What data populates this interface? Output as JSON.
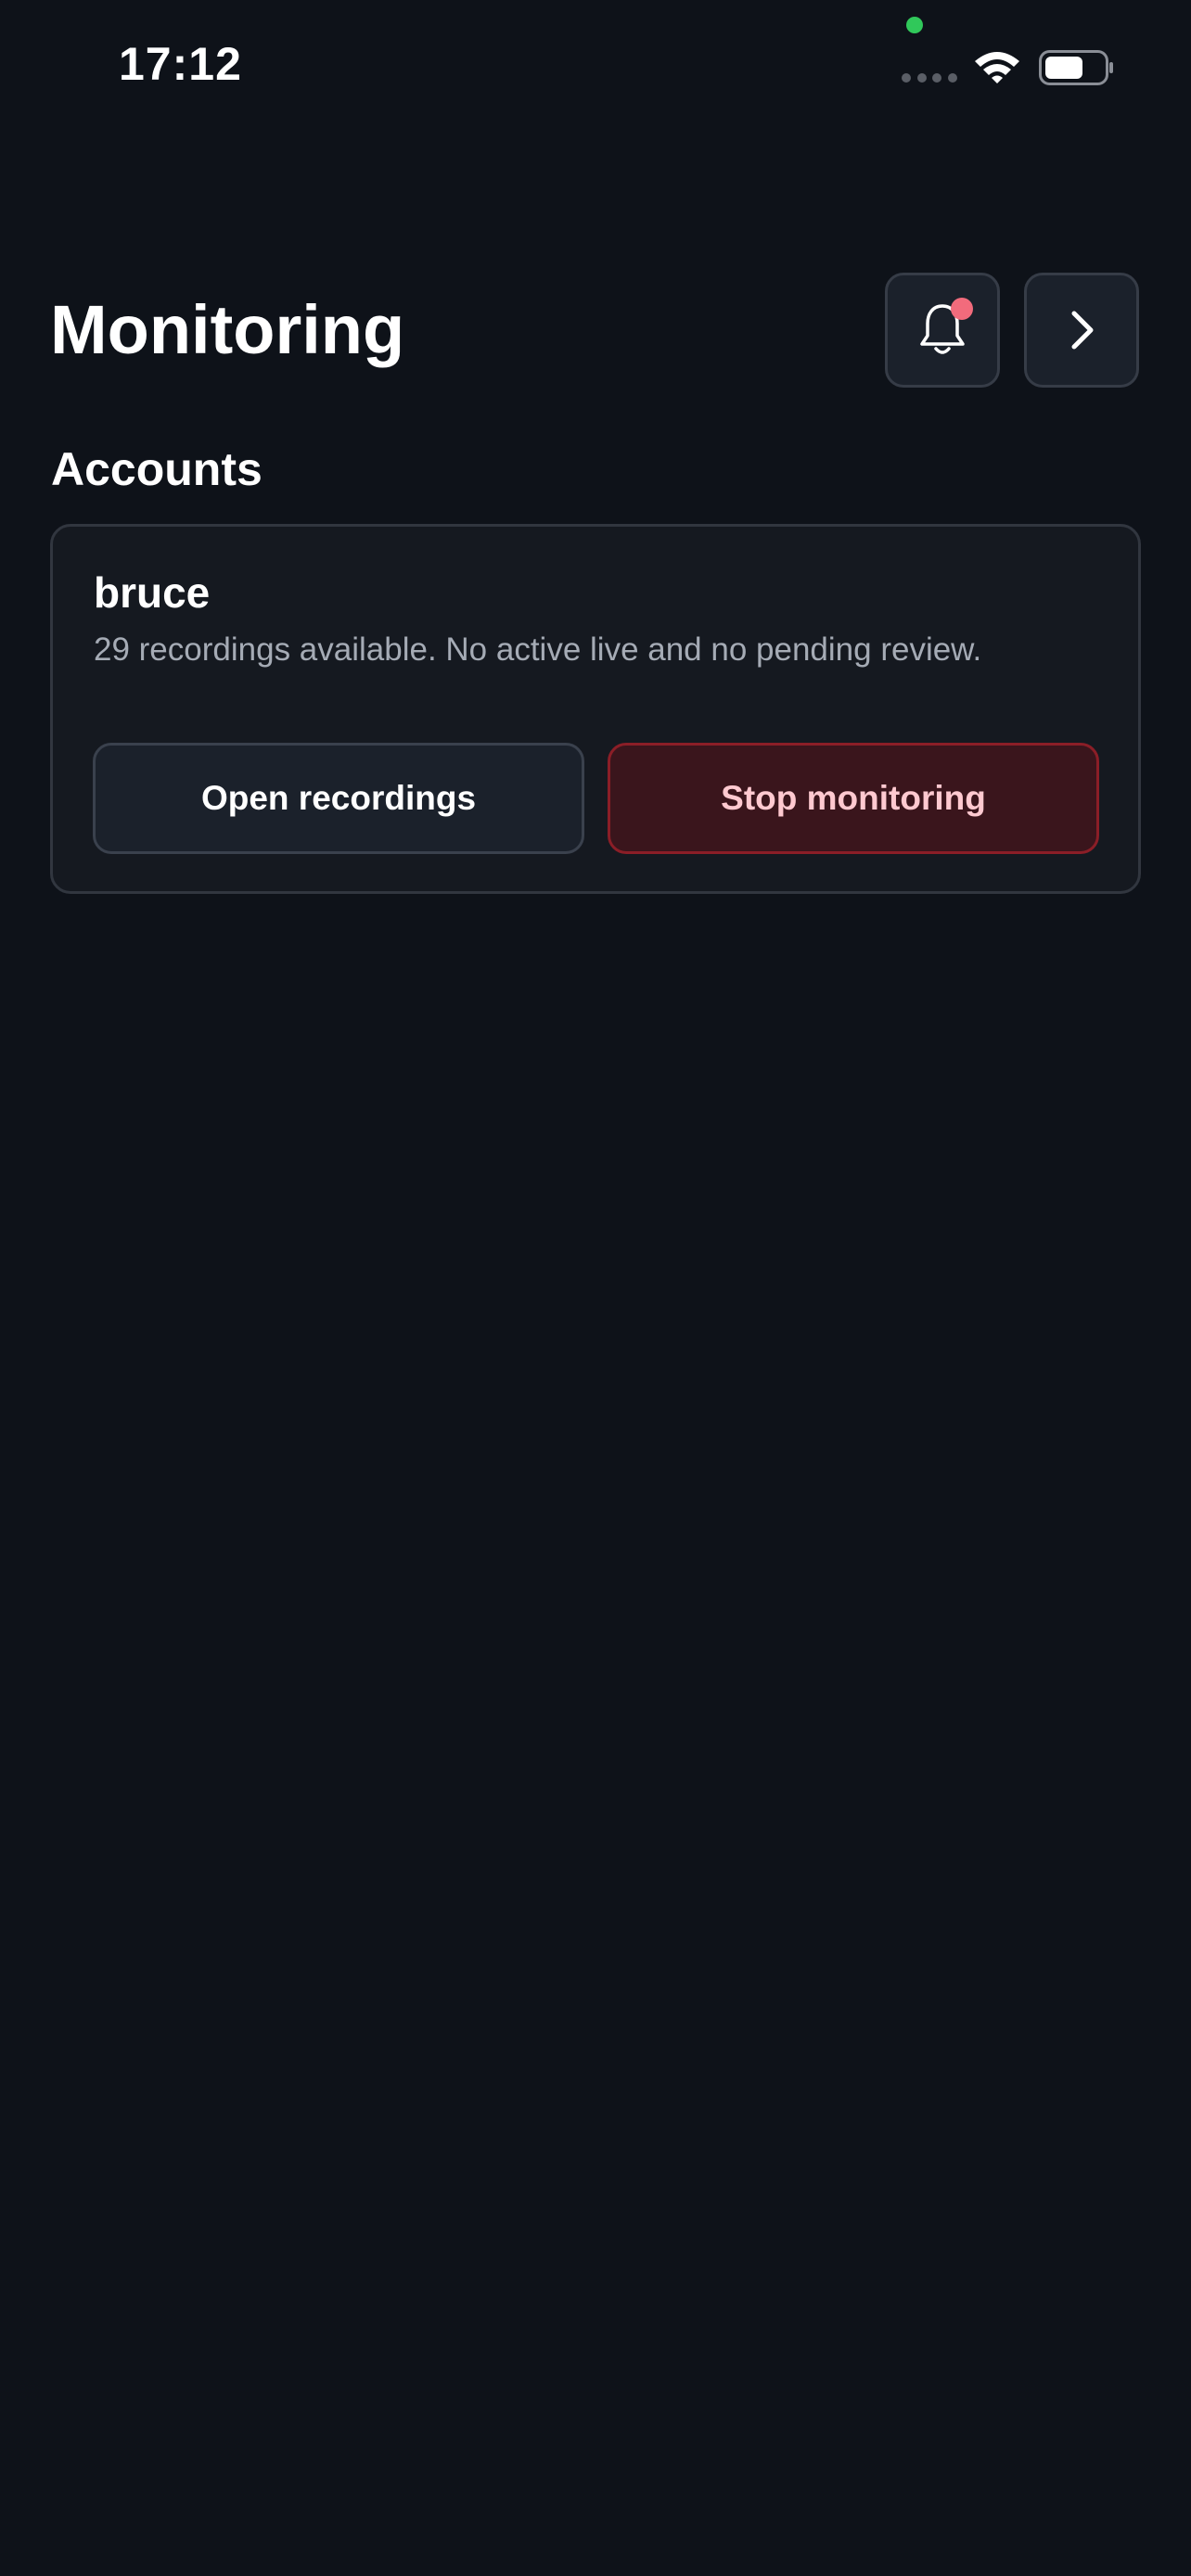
{
  "status_bar": {
    "time": "17:12",
    "icons": [
      "privacy-indicator-dot",
      "cellular-signal-icon",
      "wifi-icon",
      "battery-icon"
    ]
  },
  "header": {
    "title": "Monitoring",
    "notifications_icon": "bell-icon",
    "notifications_has_unread": true,
    "next_icon": "chevron-right-icon"
  },
  "accounts": {
    "heading": "Accounts",
    "items": [
      {
        "name": "bruce",
        "summary": "29 recordings available. No active live and no pending review.",
        "open_label": "Open recordings",
        "stop_label": "Stop monitoring"
      }
    ]
  },
  "colors": {
    "background": "#0e1219",
    "card": "#151920",
    "badge": "#f26b7c",
    "danger_border": "#8b1e27",
    "danger_fill": "#3a151c",
    "danger_text": "#ffc9d0",
    "privacy_dot": "#30c85a"
  }
}
